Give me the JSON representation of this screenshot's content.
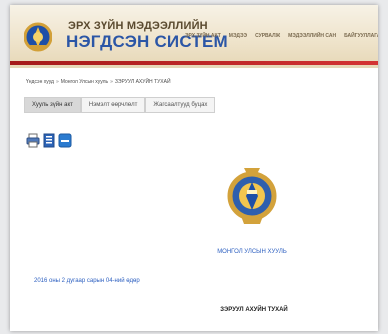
{
  "header": {
    "title_line1": "ЭРХ ЗҮЙН МЭДЭЭЛЛИЙН",
    "title_line2": "НЭГДСЭН СИСТЕМ",
    "nav": [
      "ЭРХ ЗҮЙН АКТ",
      "МЭДЭЭ",
      "СУРВАЛЖ",
      "МЭДЭЭЛЛИЙН САН",
      "БАЙГУУЛЛАГА"
    ]
  },
  "breadcrumb": [
    "Үндсэн хууд",
    "Монгол Улсын хууль",
    "ЗЭРУУЛ АХУЙН ТУХАЙ"
  ],
  "tabs": [
    "Хууль зүйн акт",
    "Нэмэлт өөрчлөлт",
    "Жагсаалтууд буцах"
  ],
  "tools": {
    "print_icon": "printer-icon",
    "word_icon": "word-document-icon",
    "minus_icon": "minus-icon"
  },
  "document": {
    "country": "МОНГОЛ УЛСЫН ХУУЛЬ",
    "date": "2016 оны 2 дугаар сарын 04-ний өдөр",
    "title": "ЗЭРУУЛ АХУЙН ТУХАЙ"
  },
  "colors": {
    "accent_blue": "#2b56a6",
    "link_blue": "#2c5fc0",
    "red_bar": "#b82020",
    "header_bg": "#efe4cc"
  }
}
